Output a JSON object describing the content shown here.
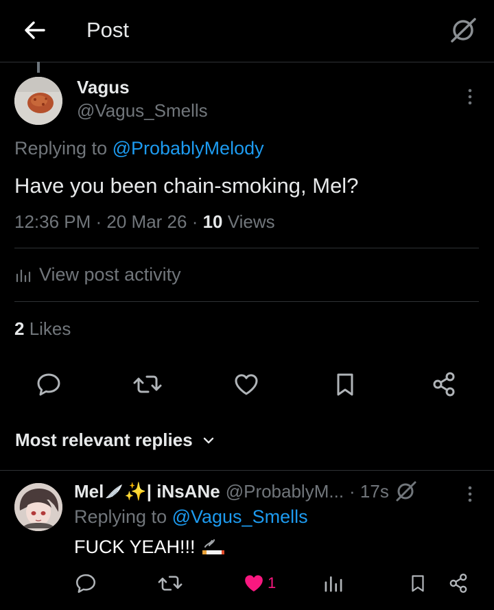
{
  "header": {
    "title": "Post"
  },
  "post": {
    "author_name": "Vagus",
    "author_handle": "@Vagus_Smells",
    "replying_prefix": "Replying to ",
    "replying_to": "@ProbablyMelody",
    "text": "Have you been chain-smoking, Mel?",
    "time": "12:36 PM",
    "date": "20 Mar 26",
    "views_count": "10",
    "views_label": " Views",
    "activity_label": "View post activity",
    "likes_count": "2",
    "likes_label": " Likes"
  },
  "replies_section": {
    "sort_label": "Most relevant replies"
  },
  "reply": {
    "author_name": "Mel",
    "name_emoji": "✨",
    "name_suffix": "| iNsANe",
    "handle": "@ProbablyM...",
    "age": "· 17s",
    "replying_prefix": "Replying to ",
    "replying_to": "@Vagus_Smells",
    "text": "FUCK YEAH!!!",
    "like_count": "1"
  },
  "colors": {
    "background": "#000000",
    "text": "#e7e9ea",
    "muted": "#71767b",
    "link": "#1d9bf0",
    "divider": "#2f3336",
    "like": "#f91880"
  }
}
